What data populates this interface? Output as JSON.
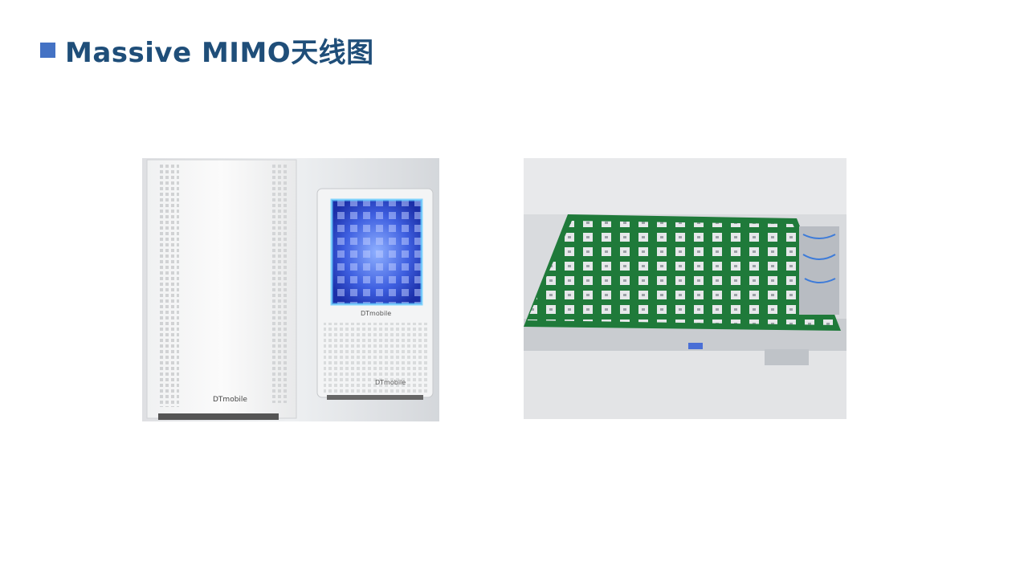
{
  "slide": {
    "title": "Massive MIMO天线图"
  },
  "photos": [
    {
      "name": "antenna-units-photo",
      "brand_text": "DTmobile"
    },
    {
      "name": "antenna-array-board-photo"
    }
  ]
}
